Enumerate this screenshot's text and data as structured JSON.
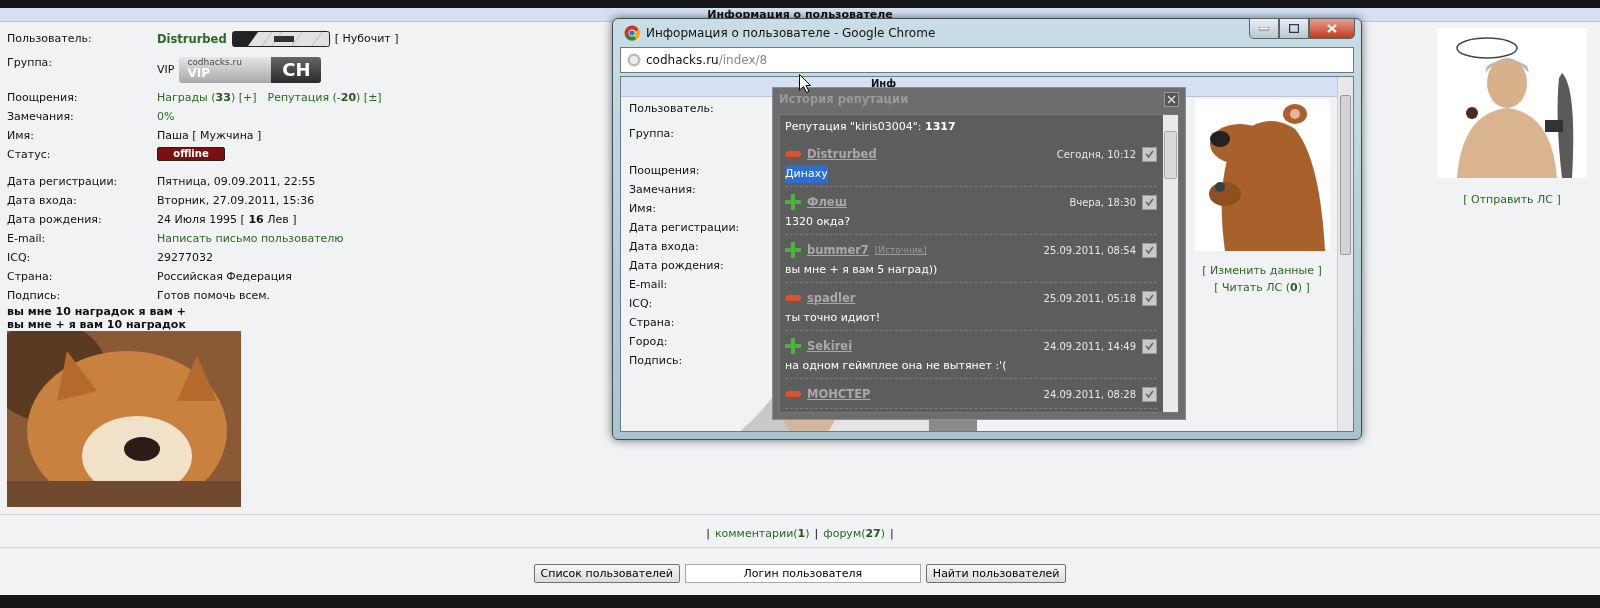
{
  "top_header": {
    "title": "Информация о пользователе"
  },
  "profile": {
    "rows": [
      {
        "kind": "user",
        "label": "Пользователь:",
        "name": "Distrurbed",
        "rank": "[ Нубочит ]"
      },
      {
        "kind": "group",
        "label": "Группа:",
        "value": "VIP",
        "badge": {
          "site": "codhacks.ru",
          "label": "VIP",
          "logo": "CH"
        }
      },
      {
        "kind": "awards",
        "label": "Поощрения:",
        "awards": "Награды (**33**) [+]",
        "reputation": "Репутация (-**20**) [±]"
      },
      {
        "kind": "link",
        "label": "Замечания:",
        "value": "0%"
      },
      {
        "kind": "text",
        "label": "Имя:",
        "value": "Паша [ Мужчина ]"
      },
      {
        "kind": "status",
        "label": "Статус:",
        "value": "offline",
        "online": false
      },
      {
        "kind": "text",
        "label": "Дата регистрации:",
        "value": "Пятница, 09.09.2011, 22:55"
      },
      {
        "kind": "text",
        "label": "Дата входа:",
        "value": "Вторник, 27.09.2011, 15:36"
      },
      {
        "kind": "text",
        "label": "Дата рождения:",
        "value": "24 Июля 1995 [ **16** Лев ]"
      },
      {
        "kind": "link",
        "label": "E-mail:",
        "value": "Написать письмо пользователю"
      },
      {
        "kind": "text",
        "label": "ICQ:",
        "value": "29277032"
      },
      {
        "kind": "text",
        "label": "Страна:",
        "value": "Российская Федерация"
      },
      {
        "kind": "text",
        "label": "Подпись:",
        "value": "Готов помочь всем."
      }
    ],
    "signature_lines": [
      "вы мне 10 наградок я вам +",
      "вы мне + я вам 10 наградок"
    ],
    "signature_image": {
      "kind": "picture"
    }
  },
  "side": {
    "avatar": {
      "kind": "picture"
    },
    "send_message": "[ Отправить ЛС ]"
  },
  "footer_links": {
    "separators": [
      "|",
      "|",
      "|"
    ],
    "items": [
      "комментарии(**1**)",
      "форум(**27**)"
    ]
  },
  "search": {
    "list_button": "Список пользователей",
    "login_field": {
      "value": "Логин пользователя"
    },
    "find_button": "Найти пользователей"
  },
  "browser": {
    "title": "Информация о пользователе - Google Chrome",
    "address": {
      "host": "codhacks.ru",
      "path": "/index/8"
    },
    "page": {
      "header": "Инф",
      "labels": [
        {
          "kind": "user",
          "text": "Пользователь:"
        },
        {
          "kind": "group",
          "text": "Группа:"
        },
        {
          "kind": "text",
          "text": "Поощрения:"
        },
        {
          "kind": "text",
          "text": "Замечания:"
        },
        {
          "kind": "text",
          "text": "Имя:"
        },
        {
          "kind": "text",
          "text": "Дата регистрации:"
        },
        {
          "kind": "text",
          "text": "Дата входа:"
        },
        {
          "kind": "text",
          "text": "Дата рождения:"
        },
        {
          "kind": "text",
          "text": "E-mail:"
        },
        {
          "kind": "text",
          "text": "ICQ:"
        },
        {
          "kind": "text",
          "text": "Страна:"
        },
        {
          "kind": "text",
          "text": "Город:"
        },
        {
          "kind": "text",
          "text": "Подпись:"
        }
      ],
      "avatar": {
        "kind": "picture"
      },
      "signature_image": {
        "kind": "picture"
      },
      "links": [
        "[ Изменить данные ]",
        "[ Читать ЛС (**0**) ]"
      ]
    }
  },
  "reputation_popup": {
    "title": "История репутации",
    "summary": "Репутация \"kiris03004\": **1317**",
    "entries": [
      {
        "kind": "minus",
        "user": "Distrurbed",
        "date": "Сегодня, 10:12",
        "checked": true,
        "comment": "Динаху",
        "highlighted": true
      },
      {
        "kind": "plus",
        "user": "Флеш",
        "date": "Вчера, 18:30",
        "checked": true,
        "comment": "1320 окда?",
        "highlighted": false
      },
      {
        "kind": "plus",
        "user": "bummer7",
        "source": "[Источник]",
        "date": "25.09.2011, 08:54",
        "checked": true,
        "comment": "вы мне + я вам 5 наград))",
        "highlighted": false
      },
      {
        "kind": "minus",
        "user": "spadler",
        "date": "25.09.2011, 05:18",
        "checked": true,
        "comment": "ты точно идиот!",
        "highlighted": false
      },
      {
        "kind": "plus",
        "user": "Sekirei",
        "date": "24.09.2011, 14:49",
        "checked": true,
        "comment": "на одном геймплее она не вытянет :'(",
        "highlighted": false
      },
      {
        "kind": "minus",
        "user": "МОНСТЕР",
        "date": "24.09.2011, 08:28",
        "checked": true
      }
    ]
  }
}
